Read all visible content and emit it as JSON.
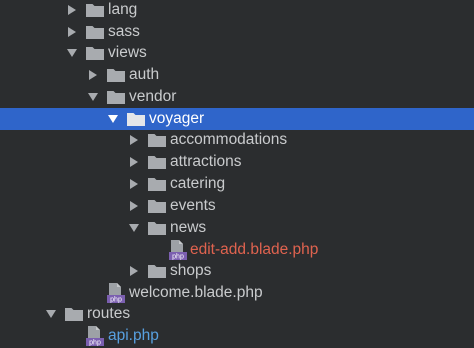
{
  "colors": {
    "background": "#2b2d2f",
    "selection": "#2f65ca",
    "text": "#c9cbcd",
    "modified_text": "#e0634f",
    "added_text": "#58a0e0",
    "folder": "#a8abaf"
  },
  "tree": {
    "items": [
      {
        "label": "lang",
        "icon": "folder-icon",
        "state": "collapsed"
      },
      {
        "label": "sass",
        "icon": "folder-icon",
        "state": "collapsed"
      },
      {
        "label": "views",
        "icon": "folder-icon",
        "state": "expanded"
      },
      {
        "label": "auth",
        "icon": "folder-icon",
        "state": "collapsed"
      },
      {
        "label": "vendor",
        "icon": "folder-icon",
        "state": "expanded"
      },
      {
        "label": "voyager",
        "icon": "folder-icon",
        "state": "expanded",
        "selected": true
      },
      {
        "label": "accommodations",
        "icon": "folder-icon",
        "state": "collapsed"
      },
      {
        "label": "attractions",
        "icon": "folder-icon",
        "state": "collapsed"
      },
      {
        "label": "catering",
        "icon": "folder-icon",
        "state": "collapsed"
      },
      {
        "label": "events",
        "icon": "folder-icon",
        "state": "collapsed"
      },
      {
        "label": "news",
        "icon": "folder-icon",
        "state": "expanded"
      },
      {
        "label": "edit-add.blade.php",
        "icon": "php-file-icon",
        "badge": "php",
        "status": "modified"
      },
      {
        "label": "shops",
        "icon": "folder-icon",
        "state": "collapsed"
      },
      {
        "label": "welcome.blade.php",
        "icon": "php-file-icon",
        "badge": "php"
      },
      {
        "label": "routes",
        "icon": "folder-icon",
        "state": "expanded"
      },
      {
        "label": "api.php",
        "icon": "php-file-icon",
        "badge": "php",
        "status": "added"
      }
    ]
  }
}
